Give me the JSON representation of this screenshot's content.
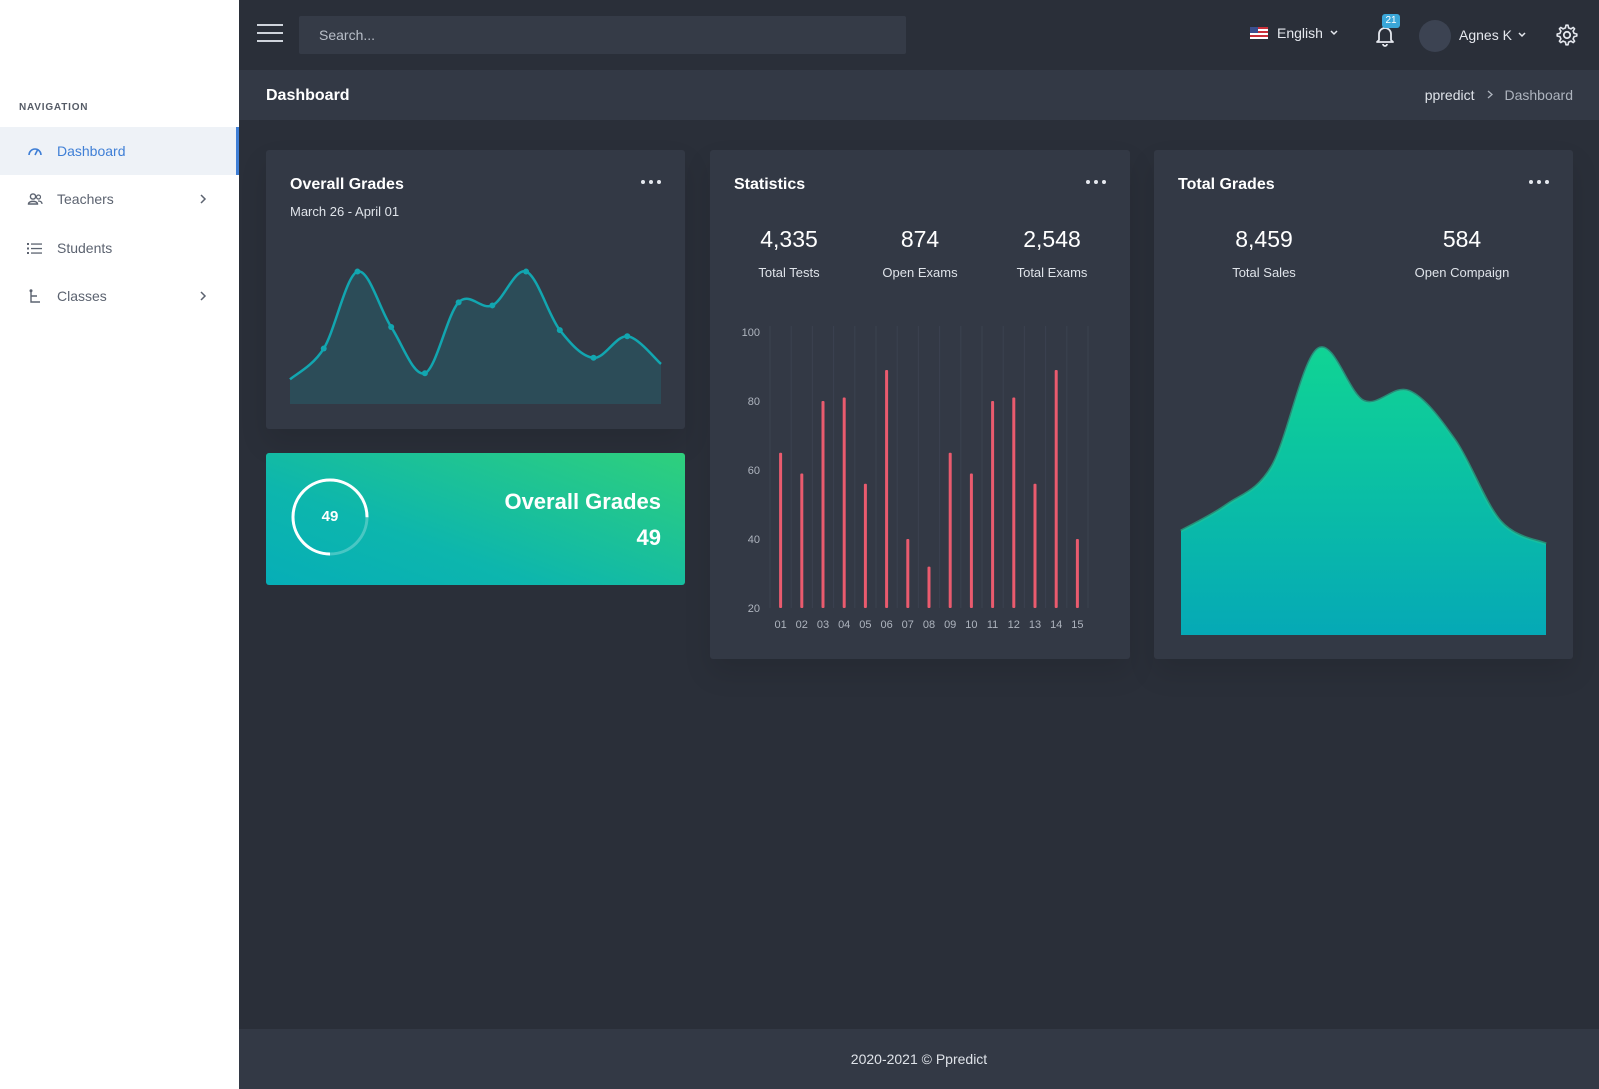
{
  "sidebar": {
    "heading": "NAVIGATION",
    "items": [
      {
        "label": "Dashboard",
        "icon": "gauge-icon"
      },
      {
        "label": "Teachers",
        "icon": "users-icon"
      },
      {
        "label": "Students",
        "icon": "list-icon"
      },
      {
        "label": "Classes",
        "icon": "tree-icon"
      }
    ]
  },
  "topbar": {
    "search_placeholder": "Search...",
    "language": "English",
    "notifications_count": "21",
    "username": "Agnes K"
  },
  "page": {
    "title": "Dashboard",
    "breadcrumb": [
      "ppredict",
      "Dashboard"
    ]
  },
  "overall_card": {
    "title": "Overall Grades",
    "subtitle": "March 26 - April 01"
  },
  "grade_summary": {
    "ring_value": "49",
    "ring_fraction": 0.75,
    "title": "Overall Grades",
    "value": "49"
  },
  "statistics_card": {
    "title": "Statistics",
    "stats": [
      {
        "value": "4,335",
        "label": "Total Tests"
      },
      {
        "value": "874",
        "label": "Open Exams"
      },
      {
        "value": "2,548",
        "label": "Total Exams"
      }
    ]
  },
  "total_card": {
    "title": "Total Grades",
    "stats": [
      {
        "value": "8,459",
        "label": "Total Sales"
      },
      {
        "value": "584",
        "label": "Open Compaign"
      }
    ]
  },
  "footer": {
    "text": "2020-2021 © Ppredict"
  },
  "colors": {
    "accent": "#3f7fd6",
    "line": "#12a6b0",
    "bar": "#ea5b6e",
    "area_top": "#10d494",
    "area_bottom": "#05a9b6"
  },
  "chart_data": [
    {
      "type": "area",
      "x": [
        1,
        2,
        3,
        4,
        5,
        6,
        7,
        8,
        9,
        10,
        11,
        12
      ],
      "values": [
        8,
        18,
        43,
        25,
        10,
        33,
        32,
        43,
        24,
        15,
        22,
        13
      ],
      "ylim": [
        0,
        50
      ]
    },
    {
      "type": "bar",
      "categories": [
        "01",
        "02",
        "03",
        "04",
        "05",
        "06",
        "07",
        "08",
        "09",
        "10",
        "11",
        "12",
        "13",
        "14",
        "15"
      ],
      "values": [
        65,
        59,
        80,
        81,
        56,
        89,
        40,
        32,
        65,
        59,
        80,
        81,
        56,
        89,
        40
      ],
      "ylim": [
        20,
        100
      ],
      "yticks": [
        20,
        40,
        60,
        80,
        100
      ]
    },
    {
      "type": "area",
      "x": [
        1,
        2,
        3,
        4,
        5,
        6,
        7,
        8,
        9
      ],
      "values": [
        32,
        40,
        52,
        88,
        72,
        75,
        60,
        35,
        28
      ],
      "ylim": [
        0,
        100
      ]
    }
  ]
}
